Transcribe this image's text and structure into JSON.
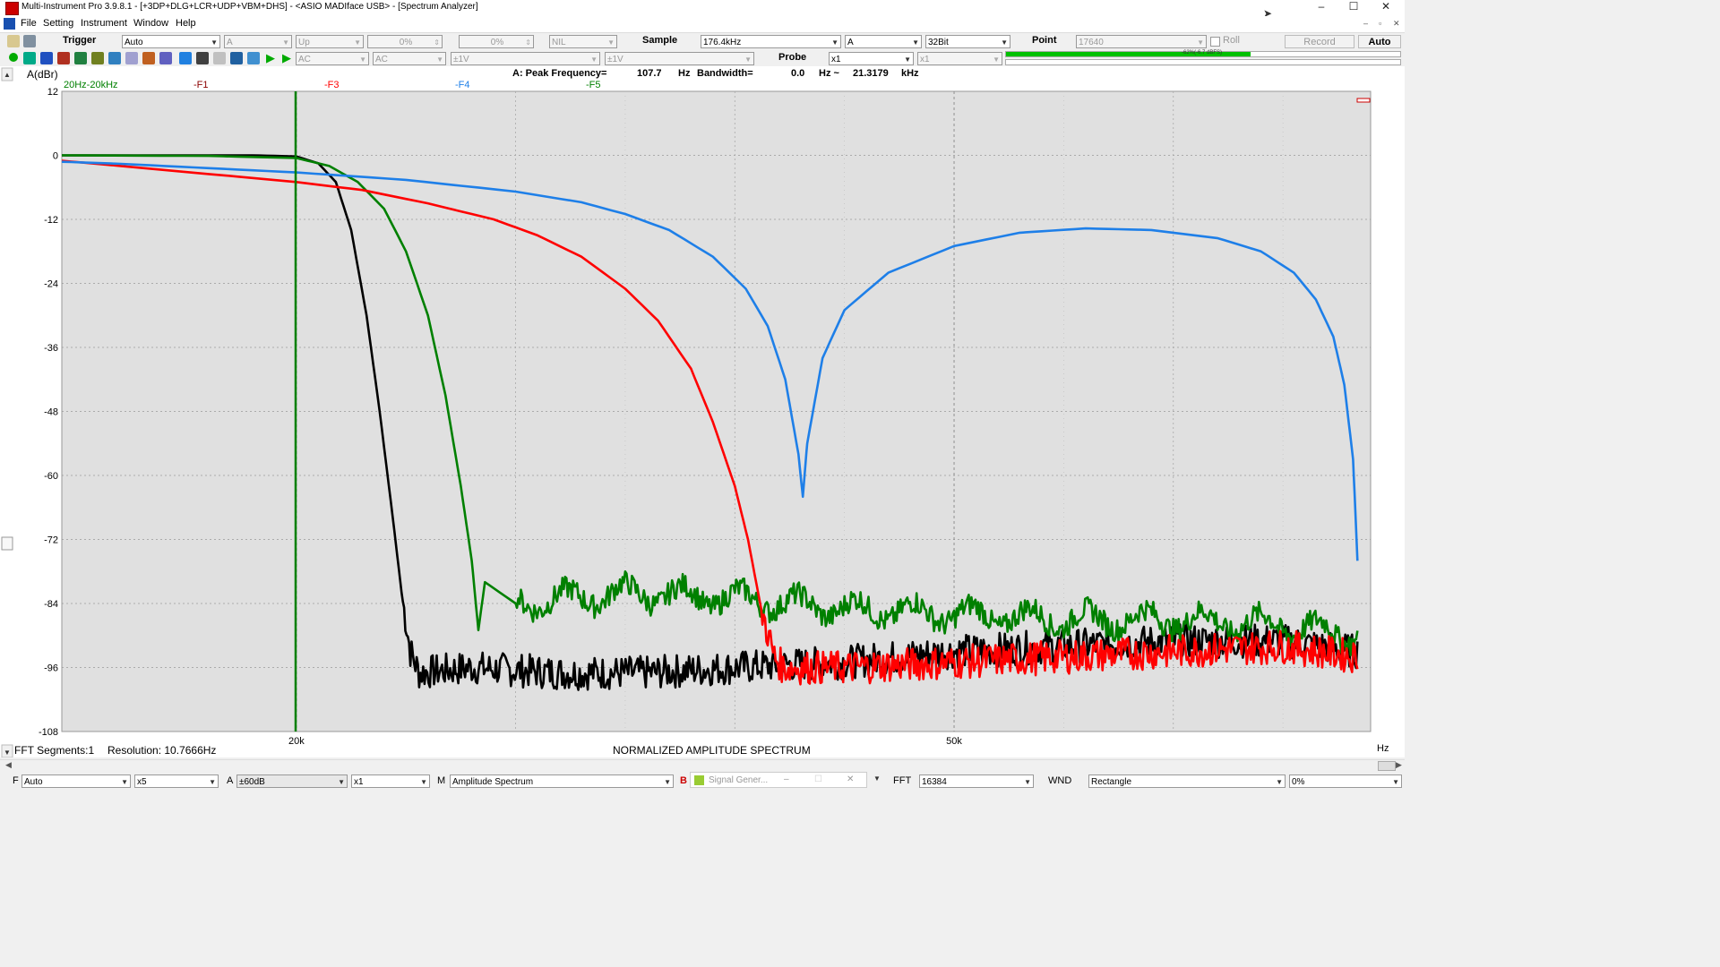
{
  "titlebar": {
    "title": "Multi-Instrument Pro 3.9.8.1  -   [+3DP+DLG+LCR+UDP+VBM+DHS]   -   <ASIO MADIface USB> - [Spectrum Analyzer]",
    "minimize": "–",
    "maximize": "☐",
    "close": "✕"
  },
  "menu": {
    "file": "File",
    "setting": "Setting",
    "instrument": "Instrument",
    "window": "Window",
    "help": "Help",
    "mdi_min": "–",
    "mdi_restore": "▫",
    "mdi_close": "✕"
  },
  "toolbar1": {
    "trigger_label": "Trigger",
    "trigger_mode": "Auto",
    "trigger_channel": "A",
    "trigger_edge": "Up",
    "trigger_level": "0%",
    "trigger_delay": "0%",
    "trigger_extra": "NIL",
    "sample_label": "Sample",
    "sample_rate": "176.4kHz",
    "sample_channel": "A",
    "bit_depth": "32Bit",
    "point_label": "Point",
    "point_value": "17640",
    "roll_label": "Roll",
    "record_label": "Record",
    "auto_label": "Auto"
  },
  "toolbar2": {
    "coupling_a": "AC",
    "coupling_b": "AC",
    "range_a": "±1V",
    "range_b": "±1V",
    "probe_label": "Probe",
    "probe_a": "x1",
    "probe_b": "x1",
    "level_meter_text": "-62%(-6.7 dBFS)",
    "level_fraction": 0.62
  },
  "plot": {
    "ylabel": "A(dBr)",
    "peak_text": "A: Peak Frequency=",
    "peak_value": "107.7",
    "peak_unit": "Hz",
    "bandwidth_text": "Bandwidth=",
    "bandwidth_value": "0.0",
    "bandwidth_unit": "Hz ~",
    "bandwidth_high": "21.3179",
    "bandwidth_high_unit": "kHz",
    "band_label": "20Hz-20kHz",
    "marker_f1": "-F1",
    "marker_f3": "-F3",
    "marker_f4": "-F4",
    "marker_f5": "-F5",
    "segments_text": "FFT Segments:1",
    "resolution_text": "Resolution: 10.7666Hz",
    "caption": "NORMALIZED AMPLITUDE SPECTRUM",
    "x_unit": "Hz",
    "y_ticks": [
      "12",
      "0",
      "-12",
      "-24",
      "-36",
      "-48",
      "-60",
      "-72",
      "-84",
      "-96",
      "-108"
    ],
    "x_ticks": [
      "20k",
      "50k"
    ]
  },
  "statusbar": {
    "f_label": "F",
    "f_value": "Auto",
    "zoom_value": "x5",
    "a_label": "A",
    "a_range": "±60dB",
    "a_mult": "x1",
    "m_label": "M",
    "m_value": "Amplitude Spectrum",
    "b_label": "B",
    "siggen_title": "Signal Gener...",
    "fft_label": "FFT",
    "fft_value": "16384",
    "wnd_label": "WND",
    "wnd_value": "Rectangle",
    "overlap_value": "0%"
  },
  "colors": {
    "black_trace": "#000000",
    "green_trace": "#008000",
    "red_trace": "#ff0000",
    "blue_trace": "#1e7fe8",
    "marker_f1": "#8b0000",
    "marker_f3": "#ff0000",
    "marker_f4": "#1e7fe8",
    "marker_f5": "#008000",
    "plot_bg": "#e0e0e0",
    "level_meter": "#00c000"
  },
  "chart_data": {
    "type": "line",
    "title": "NORMALIZED AMPLITUDE SPECTRUM",
    "xlabel": "Hz",
    "ylabel": "A(dBr)",
    "xlim": [
      9300,
      69000
    ],
    "ylim": [
      -108,
      12
    ],
    "x_major_ticks": [
      20000,
      50000
    ],
    "grid": true,
    "series": [
      {
        "color": "#1e7fe8",
        "points": [
          [
            9300,
            -1.2
          ],
          [
            12000,
            -1.6
          ],
          [
            16000,
            -2.4
          ],
          [
            20000,
            -3.2
          ],
          [
            25000,
            -4.6
          ],
          [
            30000,
            -6.8
          ],
          [
            33000,
            -8.8
          ],
          [
            35000,
            -11
          ],
          [
            37000,
            -14
          ],
          [
            39000,
            -19
          ],
          [
            40500,
            -25
          ],
          [
            41500,
            -32
          ],
          [
            42300,
            -42
          ],
          [
            42900,
            -56
          ],
          [
            43100,
            -64
          ],
          [
            43300,
            -54
          ],
          [
            44000,
            -38
          ],
          [
            45000,
            -29
          ],
          [
            47000,
            -22
          ],
          [
            50000,
            -17
          ],
          [
            53000,
            -14.5
          ],
          [
            56000,
            -13.7
          ],
          [
            59000,
            -14
          ],
          [
            62000,
            -15.5
          ],
          [
            64000,
            -18
          ],
          [
            65500,
            -22
          ],
          [
            66500,
            -27
          ],
          [
            67300,
            -34
          ],
          [
            67800,
            -43
          ],
          [
            68200,
            -57
          ],
          [
            68400,
            -76
          ]
        ]
      },
      {
        "color": "#ff0000",
        "points": [
          [
            9300,
            -1.0
          ],
          [
            12000,
            -2.0
          ],
          [
            16000,
            -3.5
          ],
          [
            20000,
            -5
          ],
          [
            23000,
            -6.5
          ],
          [
            26000,
            -9
          ],
          [
            29000,
            -12
          ],
          [
            31000,
            -15
          ],
          [
            33000,
            -19
          ],
          [
            35000,
            -25
          ],
          [
            36500,
            -31
          ],
          [
            38000,
            -40
          ],
          [
            39000,
            -50
          ],
          [
            40000,
            -62
          ],
          [
            40600,
            -72
          ],
          [
            41200,
            -85
          ],
          [
            41800,
            -94
          ],
          [
            42200,
            -96
          ],
          [
            45000,
            -96
          ],
          [
            50000,
            -95
          ],
          [
            55000,
            -94
          ],
          [
            60000,
            -93
          ],
          [
            65000,
            -92
          ],
          [
            68400,
            -94
          ]
        ]
      },
      {
        "color": "#008000",
        "points": [
          [
            9300,
            0
          ],
          [
            16000,
            -0.1
          ],
          [
            20000,
            -0.5
          ],
          [
            21500,
            -2
          ],
          [
            22800,
            -5
          ],
          [
            24000,
            -10
          ],
          [
            25000,
            -18
          ],
          [
            26000,
            -30
          ],
          [
            26800,
            -45
          ],
          [
            27500,
            -62
          ],
          [
            28000,
            -76
          ],
          [
            28300,
            -89
          ],
          [
            28600,
            -80
          ],
          [
            30000,
            -84
          ],
          [
            35000,
            -82
          ],
          [
            40000,
            -83
          ],
          [
            45000,
            -85
          ],
          [
            50000,
            -86
          ],
          [
            55000,
            -87
          ],
          [
            60000,
            -87
          ],
          [
            65000,
            -88
          ],
          [
            68400,
            -90
          ]
        ]
      },
      {
        "color": "#000000",
        "points": [
          [
            9300,
            0
          ],
          [
            18000,
            0
          ],
          [
            20000,
            -0.2
          ],
          [
            21000,
            -1.5
          ],
          [
            21800,
            -5
          ],
          [
            22500,
            -14
          ],
          [
            23200,
            -30
          ],
          [
            23800,
            -48
          ],
          [
            24400,
            -68
          ],
          [
            24800,
            -82
          ],
          [
            25200,
            -93
          ],
          [
            25600,
            -97
          ],
          [
            28000,
            -96
          ],
          [
            32000,
            -97
          ],
          [
            36000,
            -97
          ],
          [
            40000,
            -96
          ],
          [
            45000,
            -95
          ],
          [
            50000,
            -93
          ],
          [
            55000,
            -92
          ],
          [
            60000,
            -91
          ],
          [
            65000,
            -91
          ],
          [
            68400,
            -93
          ]
        ]
      }
    ]
  }
}
